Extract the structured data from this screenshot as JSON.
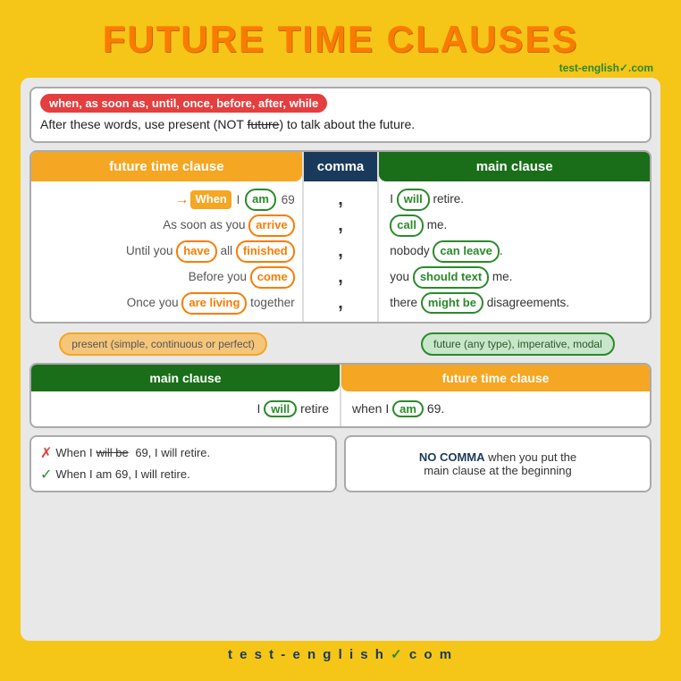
{
  "title": "FUTURE TIME CLAUSES",
  "branding": "test-english",
  "branding_tld": ".com",
  "info": {
    "keywords": "when, as soon as, until, once, before, after, while",
    "description": "After these words, use present (NOT future) to talk about the future."
  },
  "table": {
    "col_future_header": "future time clause",
    "col_comma_header": "comma",
    "col_main_header": "main clause",
    "rows": [
      {
        "future": "When I am 69",
        "when_word": "When",
        "when_highlight": "orange",
        "am_highlight": "green_outline",
        "comma": ",",
        "main": "I will retire.",
        "will_highlight": "green_outline"
      },
      {
        "future": "As soon as you arrive",
        "arrive_highlight": "orange_outline",
        "comma": ",",
        "main": "call me.",
        "call_highlight": "green_outline"
      },
      {
        "future": "Until you have all finished",
        "have_highlight": "orange_outline",
        "finished_highlight": "orange_outline",
        "comma": ",",
        "main": "nobody can leave.",
        "canleave_highlight": "green_outline"
      },
      {
        "future": "Before you come",
        "come_highlight": "orange_outline",
        "comma": ",",
        "main": "you should text me.",
        "shouldtext_highlight": "green_outline"
      },
      {
        "future": "Once you are living together",
        "areliving_highlight": "orange_outline",
        "comma": ",",
        "main": "there might be disagreements.",
        "mightbe_highlight": "green_outline"
      }
    ],
    "label_future": "present (simple, continuous or perfect)",
    "label_main": "future (any type), imperative, modal"
  },
  "reversed": {
    "main_header": "main clause",
    "future_header": "future time clause",
    "main_text": "I",
    "main_will": "will",
    "main_rest": "retire",
    "future_text": "when I",
    "future_am": "am",
    "future_rest": "69."
  },
  "examples": {
    "wrong": "When I will be 69, I will retire.",
    "wrong_strikethrough": "will be",
    "correct": "When I am 69, I will retire."
  },
  "no_comma_note": "NO COMMA when you put the main clause at the beginning",
  "footer": "t e s t - e n g l i s h . c o m"
}
